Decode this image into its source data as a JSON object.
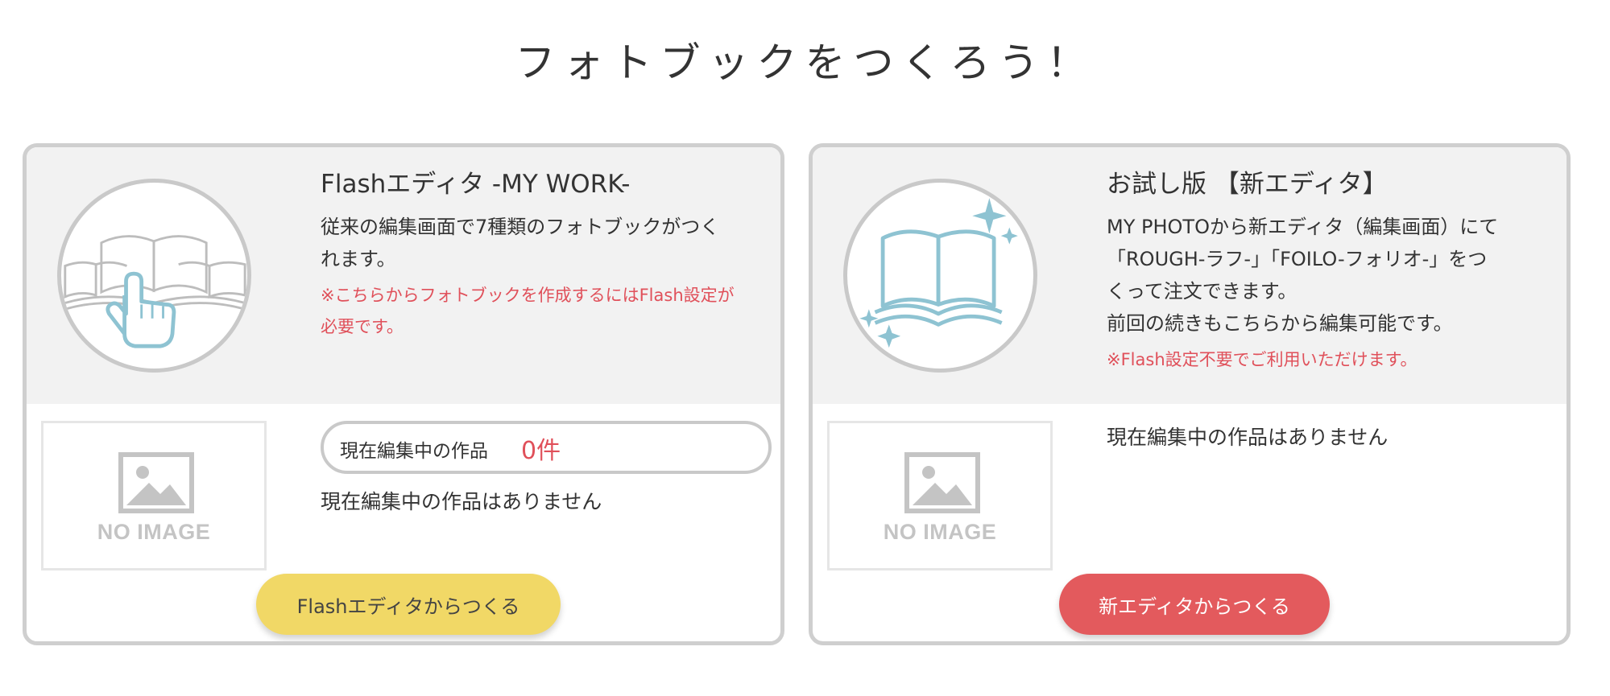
{
  "page": {
    "title": "フォトブックをつくろう！"
  },
  "flash_card": {
    "title": "Flashエディタ -MY WORK-",
    "desc_line1": "従来の編集画面で7種類のフォトブックがつく",
    "desc_line2": "れます。",
    "note_line1": "※こちらからフォトブックを作成するにはFlash設定が",
    "note_line2": "必要です。",
    "thumbnail_text": "NO IMAGE",
    "count_label": "現在編集中の作品",
    "count_value": "0件",
    "empty_message": "現在編集中の作品はありません",
    "button_label": "Flashエディタからつくる",
    "icon": "book-with-pointer-icon"
  },
  "new_card": {
    "title": "お試し版 【新エディタ】",
    "desc_line1": "MY PHOTOから新エディタ（編集画面）にて",
    "desc_line2": "「ROUGH-ラフ-」「FOILO-フォリオ-」をつ",
    "desc_line3": "くって注文できます。",
    "desc_line4": "前回の続きもこちらから編集可能です。",
    "note_line1": "※Flash設定不要でご利用いただけます。",
    "thumbnail_text": "NO IMAGE",
    "empty_message": "現在編集中の作品はありません",
    "button_label": "新エディタからつくる",
    "icon": "sparkling-book-icon"
  },
  "colors": {
    "accent_red": "#e0505a",
    "flash_button": "#f1d866",
    "new_button": "#e35a5d",
    "icon_blue": "#8ec3d2",
    "panel_gray": "#f2f2f2"
  }
}
